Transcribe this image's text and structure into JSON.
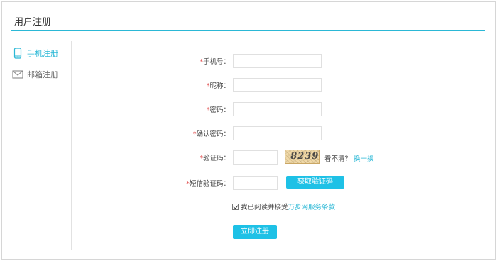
{
  "header": {
    "title": "用户注册"
  },
  "sidebar": {
    "items": [
      {
        "label": "手机注册",
        "icon": "phone-icon",
        "active": true
      },
      {
        "label": "邮箱注册",
        "icon": "envelope-icon",
        "active": false
      }
    ]
  },
  "form": {
    "required_mark": "*",
    "phone": {
      "label": "手机号：",
      "value": "",
      "placeholder": ""
    },
    "nickname": {
      "label": "昵称：",
      "value": "",
      "placeholder": ""
    },
    "password": {
      "label": "密码：",
      "value": "",
      "placeholder": ""
    },
    "confirm_password": {
      "label": "确认密码：",
      "value": "",
      "placeholder": ""
    },
    "captcha": {
      "label": "验证码：",
      "value": "",
      "image_text": "8239",
      "cant_see": "看不清？",
      "refresh": "换一换"
    },
    "sms_code": {
      "label": "短信验证码：",
      "value": "",
      "button": "获取验证码"
    },
    "agreement": {
      "text": "我已阅读并接受",
      "link": "万步网服务条款",
      "checked": true
    },
    "submit": "立即注册"
  },
  "colors": {
    "accent": "#2bb8d6",
    "button": "#1ec1e6",
    "required": "#e14b4b"
  }
}
